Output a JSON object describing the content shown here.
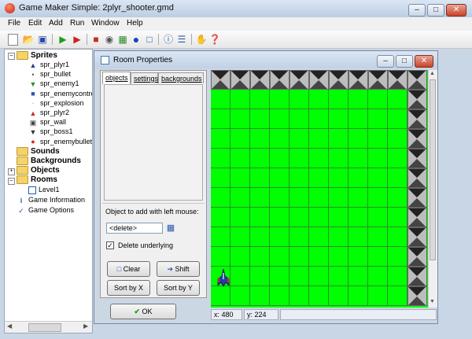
{
  "window": {
    "title": "Game Maker Simple: 2plyr_shooter.gmd"
  },
  "menu": [
    "File",
    "Edit",
    "Add",
    "Run",
    "Window",
    "Help"
  ],
  "toolbar_icons": [
    "new-icon",
    "open-icon",
    "save-icon",
    "run-icon",
    "run-debug-icon",
    "create-sprite-icon",
    "create-sound-icon",
    "create-background-icon",
    "create-object-icon",
    "create-room-icon",
    "game-info-icon",
    "game-options-icon",
    "stop-icon",
    "help-icon"
  ],
  "tree": {
    "sprites_label": "Sprites",
    "sprites": [
      "spr_plyr1",
      "spr_bullet",
      "spr_enemy1",
      "spr_enemycontro",
      "spr_explosion",
      "spr_plyr2",
      "spr_wall",
      "spr_boss1",
      "spr_enemybullet"
    ],
    "sounds_label": "Sounds",
    "backgrounds_label": "Backgrounds",
    "objects_label": "Objects",
    "rooms_label": "Rooms",
    "rooms": [
      "Level1"
    ],
    "game_info": "Game Information",
    "game_options": "Game Options"
  },
  "room_window": {
    "title": "Room Properties",
    "tabs": [
      "objects",
      "settings",
      "backgrounds"
    ],
    "object_label": "Object to add with left mouse:",
    "object_value": "<delete>",
    "delete_underlying_label": "Delete underlying",
    "delete_underlying_checked": true,
    "clear_label": "Clear",
    "shift_label": "Shift",
    "sort_x_label": "Sort by X",
    "sort_y_label": "Sort by Y",
    "ok_label": "OK",
    "status_x": "x: 480",
    "status_y": "y: 224"
  },
  "colors": {
    "room_bg": "#00ff00",
    "accent": "#2a58a8"
  }
}
